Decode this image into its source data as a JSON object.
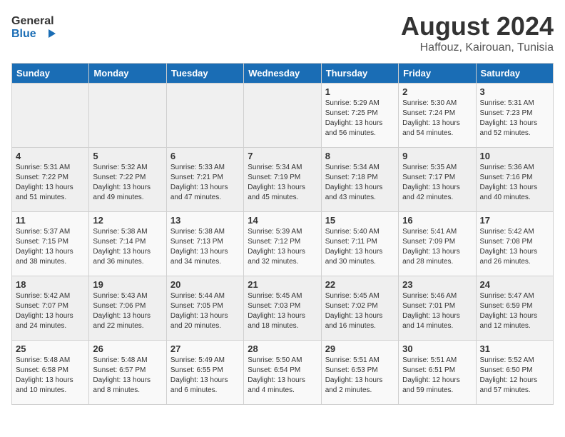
{
  "header": {
    "logo_line1": "General",
    "logo_line2": "Blue",
    "month_year": "August 2024",
    "location": "Haffouz, Kairouan, Tunisia"
  },
  "weekdays": [
    "Sunday",
    "Monday",
    "Tuesday",
    "Wednesday",
    "Thursday",
    "Friday",
    "Saturday"
  ],
  "weeks": [
    [
      {
        "day": "",
        "info": ""
      },
      {
        "day": "",
        "info": ""
      },
      {
        "day": "",
        "info": ""
      },
      {
        "day": "",
        "info": ""
      },
      {
        "day": "1",
        "info": "Sunrise: 5:29 AM\nSunset: 7:25 PM\nDaylight: 13 hours\nand 56 minutes."
      },
      {
        "day": "2",
        "info": "Sunrise: 5:30 AM\nSunset: 7:24 PM\nDaylight: 13 hours\nand 54 minutes."
      },
      {
        "day": "3",
        "info": "Sunrise: 5:31 AM\nSunset: 7:23 PM\nDaylight: 13 hours\nand 52 minutes."
      }
    ],
    [
      {
        "day": "4",
        "info": "Sunrise: 5:31 AM\nSunset: 7:22 PM\nDaylight: 13 hours\nand 51 minutes."
      },
      {
        "day": "5",
        "info": "Sunrise: 5:32 AM\nSunset: 7:22 PM\nDaylight: 13 hours\nand 49 minutes."
      },
      {
        "day": "6",
        "info": "Sunrise: 5:33 AM\nSunset: 7:21 PM\nDaylight: 13 hours\nand 47 minutes."
      },
      {
        "day": "7",
        "info": "Sunrise: 5:34 AM\nSunset: 7:19 PM\nDaylight: 13 hours\nand 45 minutes."
      },
      {
        "day": "8",
        "info": "Sunrise: 5:34 AM\nSunset: 7:18 PM\nDaylight: 13 hours\nand 43 minutes."
      },
      {
        "day": "9",
        "info": "Sunrise: 5:35 AM\nSunset: 7:17 PM\nDaylight: 13 hours\nand 42 minutes."
      },
      {
        "day": "10",
        "info": "Sunrise: 5:36 AM\nSunset: 7:16 PM\nDaylight: 13 hours\nand 40 minutes."
      }
    ],
    [
      {
        "day": "11",
        "info": "Sunrise: 5:37 AM\nSunset: 7:15 PM\nDaylight: 13 hours\nand 38 minutes."
      },
      {
        "day": "12",
        "info": "Sunrise: 5:38 AM\nSunset: 7:14 PM\nDaylight: 13 hours\nand 36 minutes."
      },
      {
        "day": "13",
        "info": "Sunrise: 5:38 AM\nSunset: 7:13 PM\nDaylight: 13 hours\nand 34 minutes."
      },
      {
        "day": "14",
        "info": "Sunrise: 5:39 AM\nSunset: 7:12 PM\nDaylight: 13 hours\nand 32 minutes."
      },
      {
        "day": "15",
        "info": "Sunrise: 5:40 AM\nSunset: 7:11 PM\nDaylight: 13 hours\nand 30 minutes."
      },
      {
        "day": "16",
        "info": "Sunrise: 5:41 AM\nSunset: 7:09 PM\nDaylight: 13 hours\nand 28 minutes."
      },
      {
        "day": "17",
        "info": "Sunrise: 5:42 AM\nSunset: 7:08 PM\nDaylight: 13 hours\nand 26 minutes."
      }
    ],
    [
      {
        "day": "18",
        "info": "Sunrise: 5:42 AM\nSunset: 7:07 PM\nDaylight: 13 hours\nand 24 minutes."
      },
      {
        "day": "19",
        "info": "Sunrise: 5:43 AM\nSunset: 7:06 PM\nDaylight: 13 hours\nand 22 minutes."
      },
      {
        "day": "20",
        "info": "Sunrise: 5:44 AM\nSunset: 7:05 PM\nDaylight: 13 hours\nand 20 minutes."
      },
      {
        "day": "21",
        "info": "Sunrise: 5:45 AM\nSunset: 7:03 PM\nDaylight: 13 hours\nand 18 minutes."
      },
      {
        "day": "22",
        "info": "Sunrise: 5:45 AM\nSunset: 7:02 PM\nDaylight: 13 hours\nand 16 minutes."
      },
      {
        "day": "23",
        "info": "Sunrise: 5:46 AM\nSunset: 7:01 PM\nDaylight: 13 hours\nand 14 minutes."
      },
      {
        "day": "24",
        "info": "Sunrise: 5:47 AM\nSunset: 6:59 PM\nDaylight: 13 hours\nand 12 minutes."
      }
    ],
    [
      {
        "day": "25",
        "info": "Sunrise: 5:48 AM\nSunset: 6:58 PM\nDaylight: 13 hours\nand 10 minutes."
      },
      {
        "day": "26",
        "info": "Sunrise: 5:48 AM\nSunset: 6:57 PM\nDaylight: 13 hours\nand 8 minutes."
      },
      {
        "day": "27",
        "info": "Sunrise: 5:49 AM\nSunset: 6:55 PM\nDaylight: 13 hours\nand 6 minutes."
      },
      {
        "day": "28",
        "info": "Sunrise: 5:50 AM\nSunset: 6:54 PM\nDaylight: 13 hours\nand 4 minutes."
      },
      {
        "day": "29",
        "info": "Sunrise: 5:51 AM\nSunset: 6:53 PM\nDaylight: 13 hours\nand 2 minutes."
      },
      {
        "day": "30",
        "info": "Sunrise: 5:51 AM\nSunset: 6:51 PM\nDaylight: 12 hours\nand 59 minutes."
      },
      {
        "day": "31",
        "info": "Sunrise: 5:52 AM\nSunset: 6:50 PM\nDaylight: 12 hours\nand 57 minutes."
      }
    ]
  ]
}
